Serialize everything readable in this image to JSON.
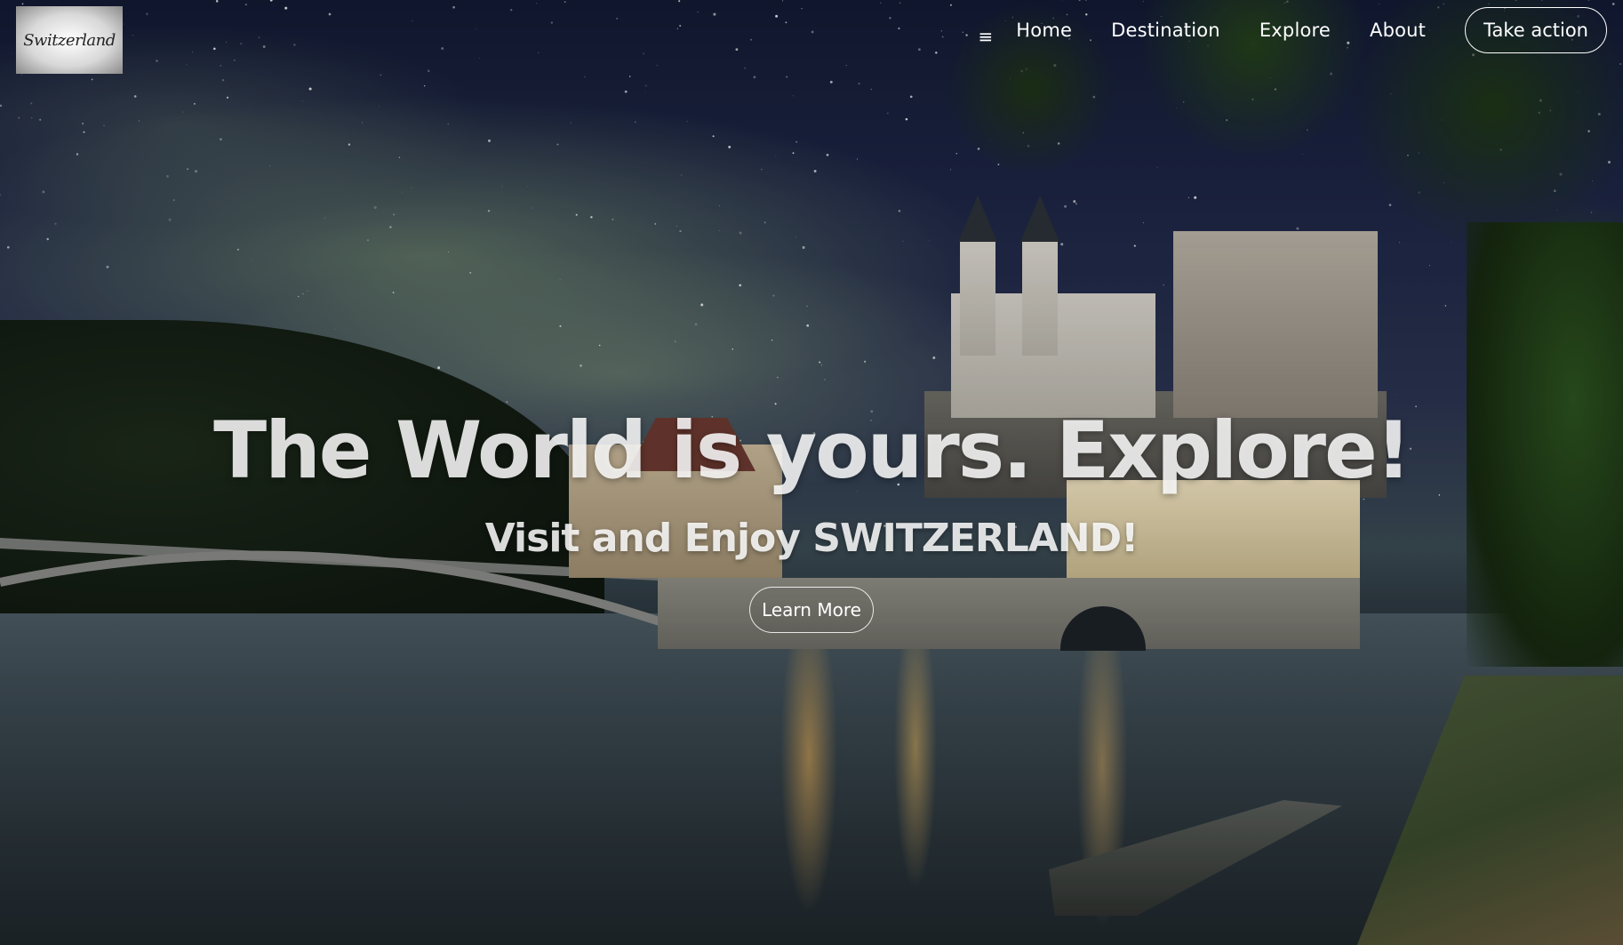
{
  "header": {
    "logo_text": "Switzerland",
    "menu_icon": "hamburger-icon",
    "nav": [
      {
        "label": "Home"
      },
      {
        "label": "Destination"
      },
      {
        "label": "Explore"
      },
      {
        "label": "About"
      }
    ],
    "cta_label": "Take action"
  },
  "hero": {
    "title": "The World is yours. Explore!",
    "subtitle": "Visit and Enjoy SWITZERLAND!",
    "button_label": "Learn More",
    "background": "night-lake-village-scene"
  },
  "colors": {
    "text": "#ffffff",
    "sky_top": "#131a33",
    "water": "#3a474f"
  }
}
